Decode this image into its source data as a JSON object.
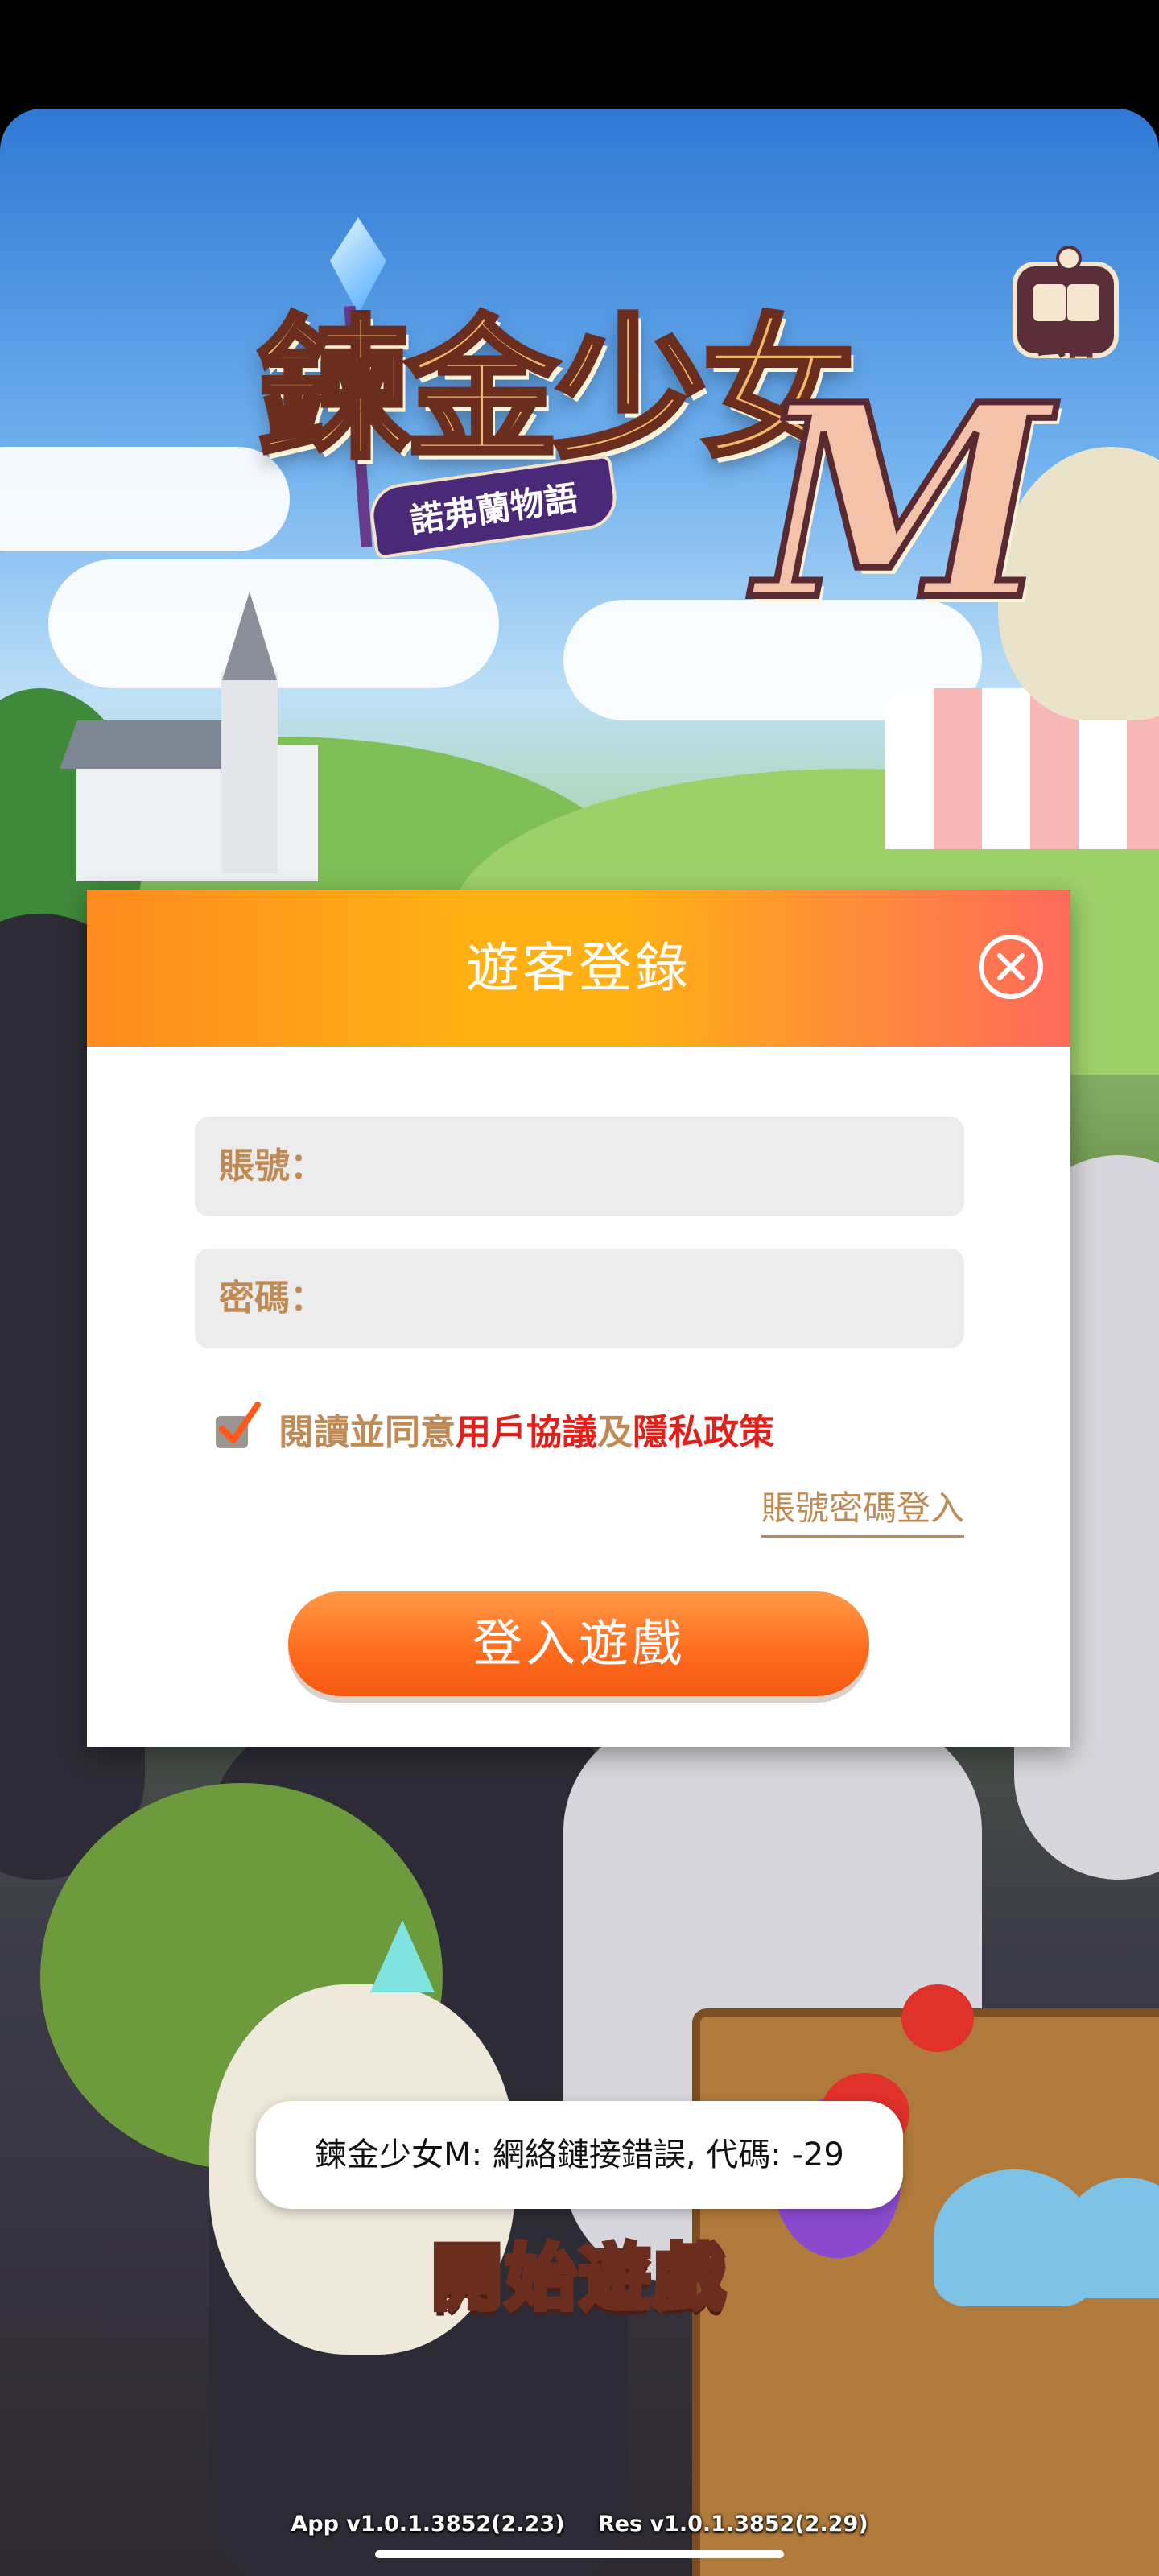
{
  "logo": {
    "title": "鍊金少女",
    "title_m": "M",
    "subtitle": "諾弗蘭物語"
  },
  "notice": {
    "label": "公告",
    "icon": "book-icon"
  },
  "login_dialog": {
    "title": "遊客登錄",
    "close_icon": "close-icon",
    "account_label": "賬號：",
    "account_value": "",
    "password_label": "密碼：",
    "password_value": "",
    "agreement": {
      "checked": true,
      "prefix": "閱讀並同意",
      "user_agreement": "用戶協議",
      "and": "及",
      "privacy_policy": "隱私政策"
    },
    "account_login_link": "賬號密碼登入",
    "login_button": "登入遊戲"
  },
  "toast": {
    "message": "鍊金少女M: 網絡鏈接錯誤, 代碼: -29"
  },
  "start_game": {
    "label": "開始遊戲"
  },
  "version": {
    "app": "App v1.0.1.3852(2.23)",
    "res": "Res v1.0.1.3852(2.29)"
  },
  "colors": {
    "header_gradient_start": "#ff8a1f",
    "header_gradient_mid": "#ffb014",
    "header_gradient_end": "#ff6a5c",
    "label_brown": "#c08a55",
    "link_red": "#e0201a",
    "button_orange": "#ff6a1c"
  }
}
